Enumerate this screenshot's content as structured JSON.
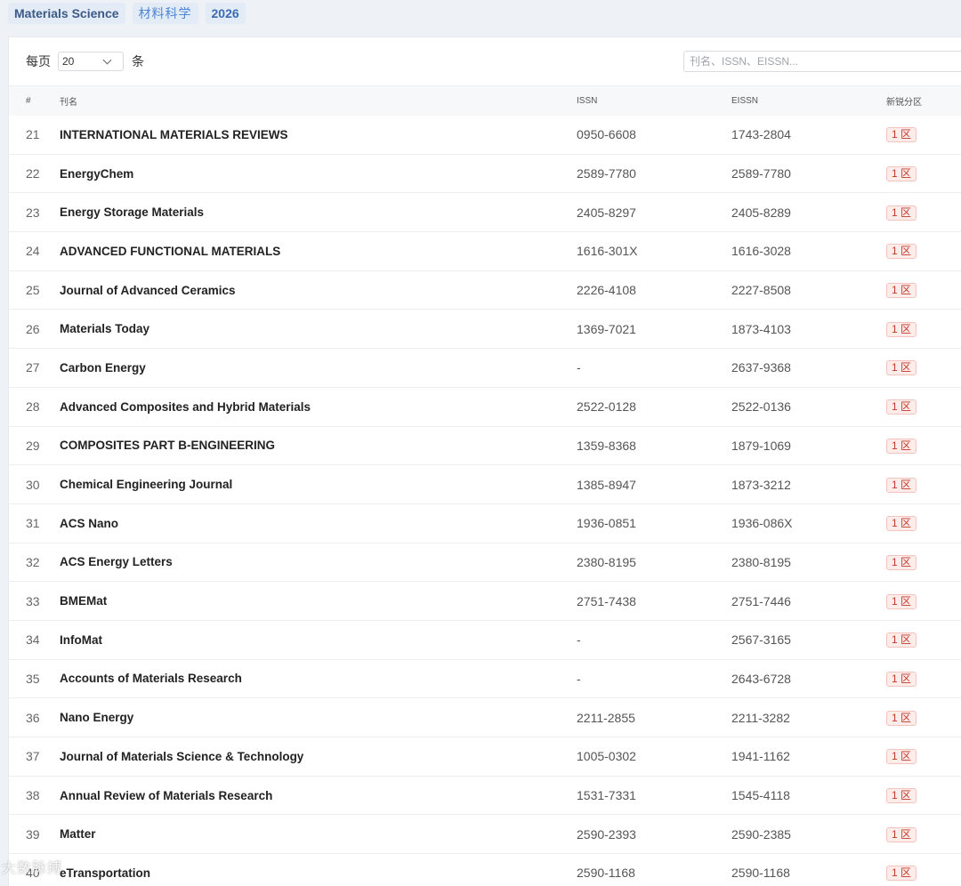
{
  "tags": [
    "Materials Science",
    "材料科学",
    "2026"
  ],
  "toolbar": {
    "per_page_label": "每页",
    "per_page_value": "20",
    "per_page_unit": "条",
    "search_placeholder": "刊名、ISSN、EISSN..."
  },
  "columns": [
    "#",
    "刊名",
    "ISSN",
    "EISSN",
    "新锐分区"
  ],
  "rows": [
    {
      "idx": "21",
      "name": "INTERNATIONAL MATERIALS REVIEWS",
      "issn": "0950-6608",
      "eissn": "1743-2804",
      "zone": "1 区"
    },
    {
      "idx": "22",
      "name": "EnergyChem",
      "issn": "2589-7780",
      "eissn": "2589-7780",
      "zone": "1 区"
    },
    {
      "idx": "23",
      "name": "Energy Storage Materials",
      "issn": "2405-8297",
      "eissn": "2405-8289",
      "zone": "1 区"
    },
    {
      "idx": "24",
      "name": "ADVANCED FUNCTIONAL MATERIALS",
      "issn": "1616-301X",
      "eissn": "1616-3028",
      "zone": "1 区"
    },
    {
      "idx": "25",
      "name": "Journal of Advanced Ceramics",
      "issn": "2226-4108",
      "eissn": "2227-8508",
      "zone": "1 区"
    },
    {
      "idx": "26",
      "name": "Materials Today",
      "issn": "1369-7021",
      "eissn": "1873-4103",
      "zone": "1 区"
    },
    {
      "idx": "27",
      "name": "Carbon Energy",
      "issn": "-",
      "eissn": "2637-9368",
      "zone": "1 区"
    },
    {
      "idx": "28",
      "name": "Advanced Composites and Hybrid Materials",
      "issn": "2522-0128",
      "eissn": "2522-0136",
      "zone": "1 区"
    },
    {
      "idx": "29",
      "name": "COMPOSITES PART B-ENGINEERING",
      "issn": "1359-8368",
      "eissn": "1879-1069",
      "zone": "1 区"
    },
    {
      "idx": "30",
      "name": "Chemical Engineering Journal",
      "issn": "1385-8947",
      "eissn": "1873-3212",
      "zone": "1 区"
    },
    {
      "idx": "31",
      "name": "ACS Nano",
      "issn": "1936-0851",
      "eissn": "1936-086X",
      "zone": "1 区"
    },
    {
      "idx": "32",
      "name": "ACS Energy Letters",
      "issn": "2380-8195",
      "eissn": "2380-8195",
      "zone": "1 区"
    },
    {
      "idx": "33",
      "name": "BMEMat",
      "issn": "2751-7438",
      "eissn": "2751-7446",
      "zone": "1 区"
    },
    {
      "idx": "34",
      "name": "InfoMat",
      "issn": "-",
      "eissn": "2567-3165",
      "zone": "1 区"
    },
    {
      "idx": "35",
      "name": "Accounts of Materials Research",
      "issn": "-",
      "eissn": "2643-6728",
      "zone": "1 区"
    },
    {
      "idx": "36",
      "name": "Nano Energy",
      "issn": "2211-2855",
      "eissn": "2211-3282",
      "zone": "1 区"
    },
    {
      "idx": "37",
      "name": "Journal of Materials Science & Technology",
      "issn": "1005-0302",
      "eissn": "1941-1162",
      "zone": "1 区"
    },
    {
      "idx": "38",
      "name": "Annual Review of Materials Research",
      "issn": "1531-7331",
      "eissn": "1545-4118",
      "zone": "1 区"
    },
    {
      "idx": "39",
      "name": "Matter",
      "issn": "2590-2393",
      "eissn": "2590-2385",
      "zone": "1 区"
    },
    {
      "idx": "40",
      "name": "eTransportation",
      "issn": "2590-1168",
      "eissn": "2590-1168",
      "zone": "1 区"
    }
  ],
  "watermark": "大数脉搏"
}
